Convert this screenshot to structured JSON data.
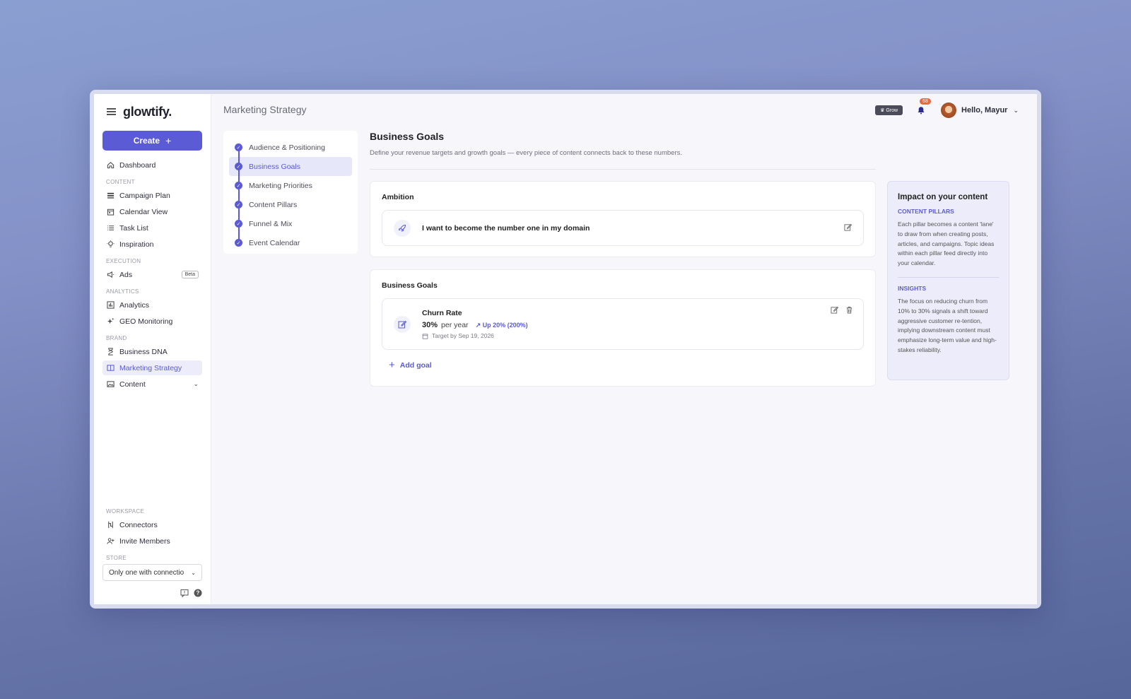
{
  "app": {
    "logo": "glowtify.",
    "create_label": "Create"
  },
  "sidebar": {
    "items": [
      {
        "label": "Dashboard",
        "icon": "home-icon"
      }
    ],
    "sections": {
      "content": "CONTENT",
      "execution": "EXECUTION",
      "analytics": "ANALYTICS",
      "brand": "BRAND",
      "workspace": "WORKSPACE",
      "store": "STORE"
    },
    "content_items": [
      "Campaign Plan",
      "Calendar View",
      "Task List",
      "Inspiration"
    ],
    "execution_items": [
      "Ads"
    ],
    "beta_label": "Beta",
    "analytics_items": [
      "Analytics",
      "GEO Monitoring"
    ],
    "brand_items": [
      "Business DNA",
      "Marketing Strategy",
      "Content"
    ],
    "workspace_items": [
      "Connectors",
      "Invite Members"
    ],
    "store_value": "Only one with connectio"
  },
  "header": {
    "page_title": "Marketing Strategy",
    "plan_badge": "Grow",
    "notification_count": "68",
    "greeting": "Hello, Mayur"
  },
  "steps": [
    {
      "label": "Audience & Positioning",
      "done": true
    },
    {
      "label": "Business Goals",
      "done": true,
      "active": true
    },
    {
      "label": "Marketing Priorities",
      "done": true
    },
    {
      "label": "Content Pillars",
      "done": true
    },
    {
      "label": "Funnel & Mix",
      "done": true
    },
    {
      "label": "Event Calendar",
      "done": true
    }
  ],
  "main": {
    "title": "Business Goals",
    "subtitle": "Define your revenue targets and growth goals — every piece of content connects back to these numbers.",
    "ambition": {
      "title": "Ambition",
      "text": "I want to become the number one in my domain"
    },
    "goals": {
      "title": "Business Goals",
      "items": [
        {
          "name": "Churn Rate",
          "value": "30%",
          "unit": "per year",
          "trend": "Up 20% (200%)",
          "target": "Target by Sep 19, 2026"
        }
      ],
      "add_label": "Add goal"
    }
  },
  "impact": {
    "title": "Impact on your content",
    "pillars_heading": "CONTENT PILLARS",
    "pillars_text": "Each pillar becomes a content 'lane' to draw from when creating posts, articles, and campaigns. Topic ideas within each pillar feed directly into your calendar.",
    "insights_heading": "INSIGHTS",
    "insights_text": "The focus on reducing churn from 10% to 30% signals a shift toward aggressive customer re-tention, implying downstream content must emphasize long-term value and high-stakes reliability."
  },
  "colors": {
    "accent": "#5b5bd6",
    "notification": "#e86a3a",
    "badge": "#4b4b5a"
  }
}
